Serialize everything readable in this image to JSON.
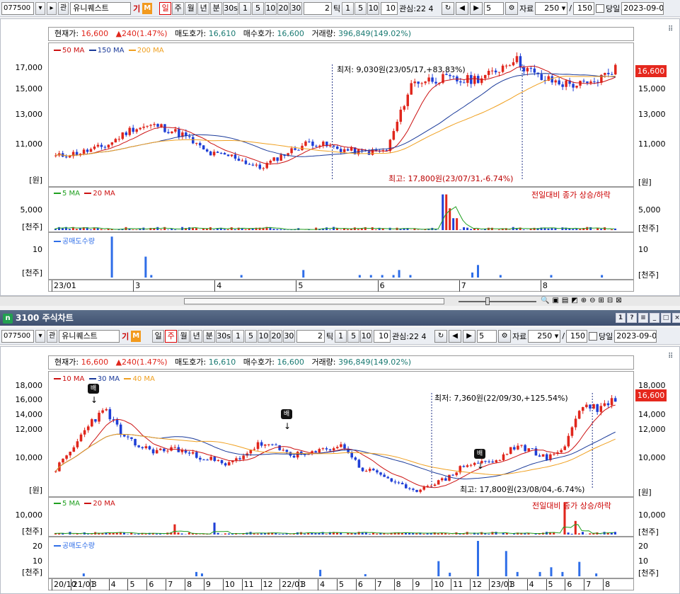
{
  "app": {
    "subwindow_title": "3100 주식차트",
    "subwindow_icon": "n"
  },
  "toolbar": {
    "code": "077500",
    "name": "유니퀘스트",
    "gi": "기",
    "m": "M",
    "gwan": "관",
    "periods": [
      "일",
      "주",
      "월",
      "년",
      "분",
      "30s",
      "1",
      "5",
      "10",
      "20",
      "30"
    ],
    "tick_count": "2",
    "tick_label": "틱",
    "tick_opts": [
      "1",
      "5",
      "10"
    ],
    "tick_val": "10",
    "gwansim": "관심:22 4",
    "num": "5",
    "jaryo_label": "자료",
    "jaryo": "250",
    "slash": "/",
    "total": "150",
    "dangil": "당일",
    "date": "2023-09-0"
  },
  "info": {
    "price_label": "현재가:",
    "price": "16,600",
    "change": "▲240(1.47%)",
    "ask_label": "매도호가:",
    "ask": "16,610",
    "bid_label": "매수호가:",
    "bid": "16,600",
    "vol_label": "거래량:",
    "vol": "396,849(149.02%)"
  },
  "top": {
    "ma_legend": [
      "50 MA",
      "150 MA",
      "200 MA"
    ],
    "yticks": [
      "17,000",
      "15,000",
      "13,000",
      "11,000"
    ],
    "unit": "[원]",
    "price_tag": "16,600",
    "note_low": "최저: 9,030원(23/05/17,+83.83%)",
    "note_high": "최고: 17,800원(23/07/31,-6.74%)",
    "vol_legend": [
      "5 MA",
      "20 MA"
    ],
    "vol_note": "전일대비 종가 상승/하락",
    "vol_ytick": "5,000",
    "vol_unit": "[천주]",
    "short_legend": "공매도수량",
    "short_ytick": "10",
    "short_unit": "[천주]",
    "xticks": [
      "23/01",
      "3",
      "4",
      "5",
      "6",
      "7",
      "8"
    ]
  },
  "bottom": {
    "ma_legend": [
      "10 MA",
      "30 MA",
      "40 MA"
    ],
    "yticks": [
      "18,000",
      "16,000",
      "14,000",
      "12,000",
      "10,000"
    ],
    "unit": "[원]",
    "price_tag": "16,600",
    "note_low": "최저: 7,360원(22/09/30,+125.54%)",
    "note_high": "최고: 17,800원(23/08/04,-6.74%)",
    "bae": "배",
    "vol_legend": [
      "5 MA",
      "20 MA"
    ],
    "vol_note": "전일대비 종가 상승/하락",
    "vol_ytick": "10,000",
    "vol_unit": "[천주]",
    "short_legend": "공매도수량",
    "short_yticks": [
      "20",
      "10"
    ],
    "short_unit": "[천주]",
    "xticks": [
      "20/10",
      "21/01",
      "3",
      "4",
      "5",
      "6",
      "7",
      "8",
      "9",
      "10",
      "11",
      "12",
      "22/01",
      "3",
      "4",
      "5",
      "6",
      "7",
      "8",
      "9",
      "10",
      "11",
      "12",
      "23/01",
      "3",
      "4",
      "5",
      "6",
      "7",
      "8"
    ]
  },
  "colors": {
    "up": "#e0261c",
    "down": "#1f3fd6",
    "ma_short": "#cc1111",
    "ma_mid": "#1a3a9a",
    "ma_long": "#f0a020",
    "vol_ma5": "#20a020",
    "short_bar": "#2f6ee8"
  },
  "chart_data": [
    {
      "type": "candlestick",
      "title": "",
      "ylabel": "[원]",
      "xlabel": "",
      "ylim": [
        8000,
        18000
      ],
      "x": [
        "23/01",
        "3",
        "4",
        "5",
        "6",
        "7",
        "8"
      ],
      "series": [
        {
          "name": "50 MA"
        },
        {
          "name": "150 MA"
        },
        {
          "name": "200 MA"
        }
      ],
      "close_path": [
        10000,
        10300,
        10800,
        12100,
        12300,
        11600,
        10200,
        10000,
        9100,
        10200,
        11100,
        10600,
        10300,
        10400,
        15500,
        15800,
        15600,
        16000,
        17300,
        15800,
        15400,
        15300,
        16600
      ],
      "current": 16600,
      "low": {
        "value": 9030,
        "date": "23/05/17"
      },
      "high": {
        "value": 17800,
        "date": "23/07/31"
      }
    },
    {
      "type": "candlestick",
      "title": "",
      "ylabel": "[원]",
      "xlabel": "",
      "ylim": [
        8000,
        18500
      ],
      "x": [
        "20/10",
        "21/01",
        "3",
        "4",
        "5",
        "6",
        "7",
        "8",
        "9",
        "10",
        "11",
        "12",
        "22/01",
        "3",
        "4",
        "5",
        "6",
        "7",
        "8",
        "9",
        "10",
        "11",
        "12",
        "23/01",
        "3",
        "4",
        "5",
        "6",
        "7",
        "8"
      ],
      "series": [
        {
          "name": "10 MA"
        },
        {
          "name": "30 MA"
        },
        {
          "name": "40 MA"
        }
      ],
      "close_path": [
        10200,
        12000,
        14500,
        15500,
        13000,
        12200,
        11800,
        12100,
        11500,
        11200,
        10500,
        11400,
        12500,
        12100,
        11500,
        11500,
        12100,
        12300,
        10200,
        9900,
        9000,
        8100,
        8800,
        9300,
        10500,
        10800,
        10900,
        12200,
        12000,
        11100,
        12300,
        16000,
        15700,
        16600
      ],
      "current": 16600,
      "low": {
        "value": 7360,
        "date": "22/09/30"
      },
      "high": {
        "value": 17800,
        "date": "23/08/04"
      }
    }
  ]
}
